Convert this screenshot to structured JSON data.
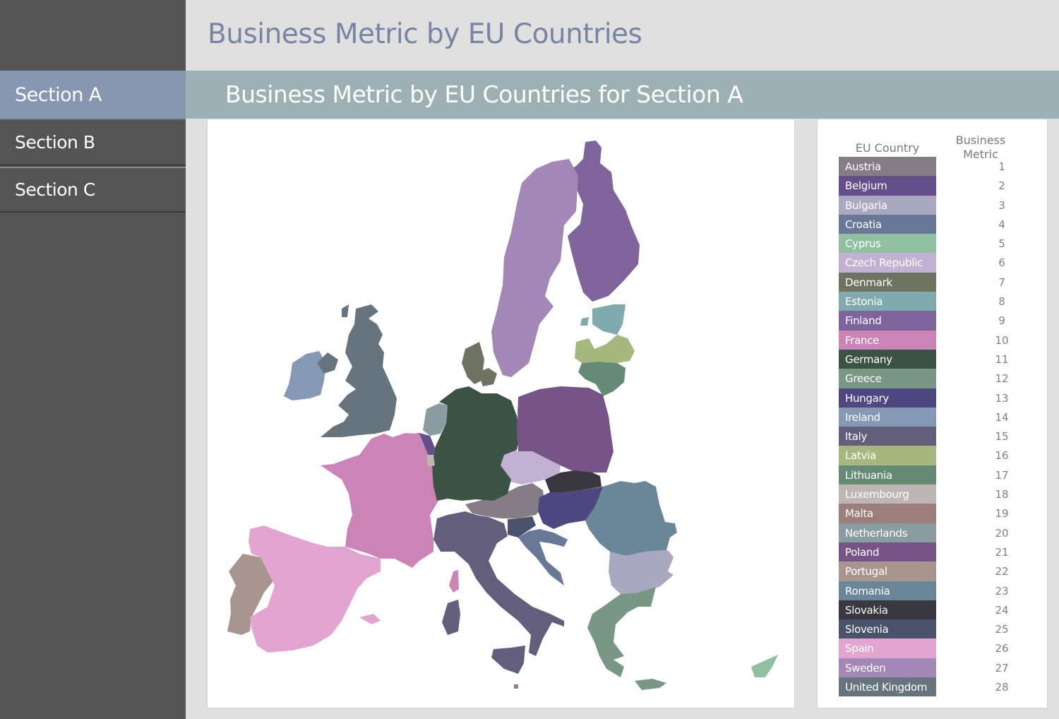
{
  "page": {
    "title": "Business Metric by EU Countries"
  },
  "sidebar": {
    "items": [
      {
        "label": "Section A",
        "active": true
      },
      {
        "label": "Section B",
        "active": false
      },
      {
        "label": "Section C",
        "active": false
      }
    ]
  },
  "section": {
    "title": "Business Metric by EU Countries for Section A"
  },
  "legend": {
    "country_header": "EU Country",
    "metric_header": "Business Metric"
  },
  "chart_data": {
    "type": "choropleth-map",
    "title": "Business Metric by EU Countries for Section A",
    "region": "European Union",
    "legend_placement": "right",
    "columns": [
      "EU Country",
      "Business Metric"
    ],
    "countries": [
      {
        "name": "Austria",
        "value": 1,
        "color": "#857c86"
      },
      {
        "name": "Belgium",
        "value": 2,
        "color": "#644f8a"
      },
      {
        "name": "Bulgaria",
        "value": 3,
        "color": "#a9a8c0"
      },
      {
        "name": "Croatia",
        "value": 4,
        "color": "#6a7898"
      },
      {
        "name": "Cyprus",
        "value": 5,
        "color": "#91bfa1"
      },
      {
        "name": "Czech Republic",
        "value": 6,
        "color": "#c2b1d2"
      },
      {
        "name": "Denmark",
        "value": 7,
        "color": "#6e7461"
      },
      {
        "name": "Estonia",
        "value": 8,
        "color": "#81aaae"
      },
      {
        "name": "Finland",
        "value": 9,
        "color": "#7f649c"
      },
      {
        "name": "France",
        "value": 10,
        "color": "#ca84b5"
      },
      {
        "name": "Germany",
        "value": 11,
        "color": "#3c5244"
      },
      {
        "name": "Greece",
        "value": 12,
        "color": "#7a9786"
      },
      {
        "name": "Hungary",
        "value": 13,
        "color": "#4f477f"
      },
      {
        "name": "Ireland",
        "value": 14,
        "color": "#8598b4"
      },
      {
        "name": "Italy",
        "value": 15,
        "color": "#645e7d"
      },
      {
        "name": "Latvia",
        "value": 16,
        "color": "#a6b77f"
      },
      {
        "name": "Lithuania",
        "value": 17,
        "color": "#668a76"
      },
      {
        "name": "Luxembourg",
        "value": 18,
        "color": "#bdb6b4"
      },
      {
        "name": "Malta",
        "value": 19,
        "color": "#9c7e7c"
      },
      {
        "name": "Netherlands",
        "value": 20,
        "color": "#8a9c9f"
      },
      {
        "name": "Poland",
        "value": 21,
        "color": "#765487"
      },
      {
        "name": "Portugal",
        "value": 22,
        "color": "#a8958f"
      },
      {
        "name": "Romania",
        "value": 23,
        "color": "#6b8599"
      },
      {
        "name": "Slovakia",
        "value": 24,
        "color": "#393740"
      },
      {
        "name": "Slovenia",
        "value": 25,
        "color": "#4a526c"
      },
      {
        "name": "Spain",
        "value": 26,
        "color": "#e2a5d0"
      },
      {
        "name": "Sweden",
        "value": 27,
        "color": "#a387b6"
      },
      {
        "name": "United Kingdom",
        "value": 28,
        "color": "#67737d"
      }
    ]
  }
}
